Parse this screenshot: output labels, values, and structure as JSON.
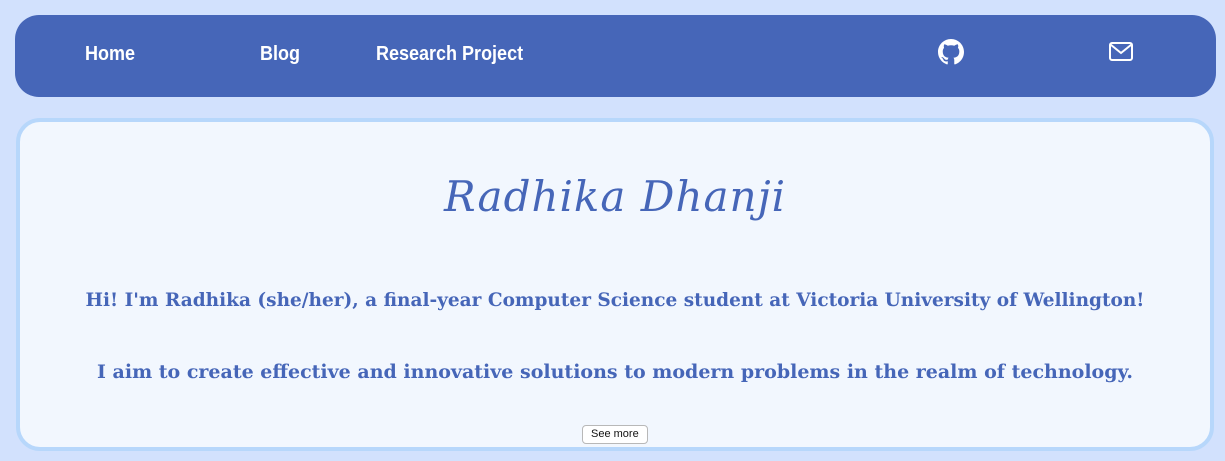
{
  "nav": {
    "home": "Home",
    "blog": "Blog",
    "research": "Research Project",
    "icons": [
      "github-icon",
      "mail-icon"
    ]
  },
  "hero": {
    "name": "Radhika Dhanji",
    "intro": "Hi! I'm Radhika (she/her), a final-year Computer Science student at Victoria University of Wellington!",
    "aim": "I aim to create effective and innovative solutions to modern problems in the realm of technology.",
    "see_more": "See more"
  },
  "colors": {
    "page_bg": "#d2e1fd",
    "nav_bg": "#4666b8",
    "card_bg": "#f2f7fe",
    "card_border": "#b7d7fb",
    "accent_text": "#4666b8"
  }
}
